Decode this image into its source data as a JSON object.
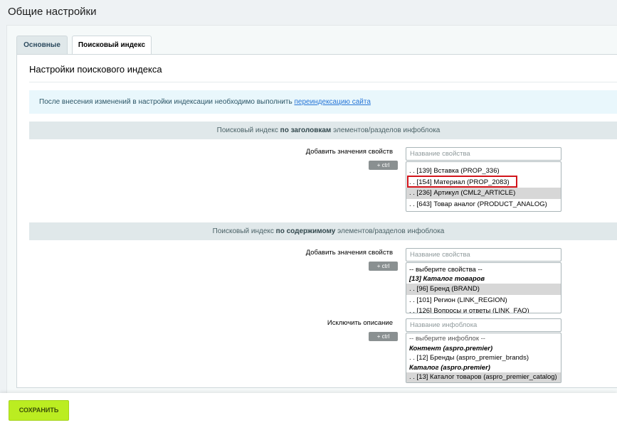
{
  "page": {
    "title": "Общие настройки"
  },
  "tabs": [
    {
      "label": "Основные",
      "active": false
    },
    {
      "label": "Поисковый индекс",
      "active": true
    }
  ],
  "section": {
    "title": "Настройки поискового индекса"
  },
  "notice": {
    "text": "После внесения изменений в настройки индексации необходимо выполнить ",
    "link": "переиндексацию сайта"
  },
  "band1": {
    "pre": "Поисковый индекс ",
    "bold": "по заголовкам",
    "post": " элементов/разделов инфоблока"
  },
  "band2": {
    "pre": "Поисковый индекс ",
    "bold": "по содержимому",
    "post": " элементов/разделов инфоблока"
  },
  "headers_block": {
    "label": "Добавить значения свойств",
    "ctrl": "+ ctrl",
    "placeholder": "Название свойства",
    "options": [
      {
        "text": ". . [139] Вставка (PROP_336)",
        "selected": false,
        "highlighted": false
      },
      {
        "text": ". . [154] Материал (PROP_2083)",
        "selected": false,
        "highlighted": true
      },
      {
        "text": ". . [236] Артикул (CML2_ARTICLE)",
        "selected": true,
        "highlighted": false
      },
      {
        "text": ". . [643] Товар аналог (PRODUCT_ANALOG)",
        "selected": false,
        "highlighted": false
      }
    ]
  },
  "content_block": {
    "label": "Добавить значения свойств",
    "ctrl": "+ ctrl",
    "placeholder": "Название свойства",
    "options": [
      {
        "text": "-- выберите свойства --",
        "type": "normal",
        "selected": false
      },
      {
        "text": "[13] Каталог товаров",
        "type": "group",
        "selected": false
      },
      {
        "text": ". . [96] Бренд (BRAND)",
        "type": "normal",
        "selected": true
      },
      {
        "text": ". . [101] Регион (LINK_REGION)",
        "type": "normal",
        "selected": false
      },
      {
        "text": ". . [126] Вопросы и ответы (LINK_FAQ)",
        "type": "normal",
        "selected": false
      }
    ]
  },
  "exclude_block": {
    "label": "Исключить описание",
    "ctrl": "+ ctrl",
    "placeholder": "Название инфоблока",
    "options": [
      {
        "text": "-- выберите инфоблок --",
        "type": "muted",
        "selected": false
      },
      {
        "text": "Контент (aspro.premier)",
        "type": "group",
        "selected": false
      },
      {
        "text": ". . [12] Бренды (aspro_premier_brands)",
        "type": "normal",
        "selected": false
      },
      {
        "text": "Каталог (aspro.premier)",
        "type": "group",
        "selected": false
      },
      {
        "text": ". . [13] Каталог товаров (aspro_premier_catalog)",
        "type": "normal",
        "selected": true
      }
    ]
  },
  "footer": {
    "save_label": "СОХРАНИТЬ"
  },
  "colors": {
    "save": "#bbed21",
    "highlight": "#d2141b",
    "band": "#e0e8ea",
    "notice": "#e9f7fc"
  }
}
